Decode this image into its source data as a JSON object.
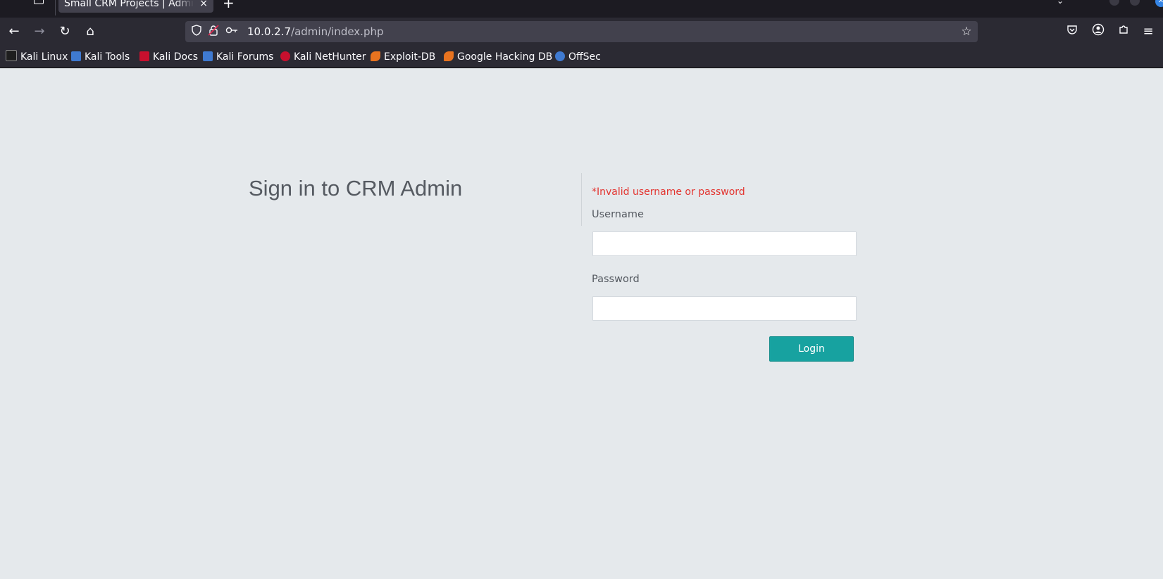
{
  "browser": {
    "tab": {
      "title": "Small CRM Projects | Admin Login",
      "close": "×"
    },
    "new_tab": "+",
    "url": {
      "host": "10.0.2.7",
      "path": "/admin/index.php"
    },
    "bookmarks": [
      {
        "label": "Kali Linux",
        "icon": "kali-dragon-icon",
        "color": "#1e1e1e"
      },
      {
        "label": "Kali Tools",
        "icon": "kali-tools-icon",
        "color": "#3f7ad1"
      },
      {
        "label": "Kali Docs",
        "icon": "kali-docs-icon",
        "color": "#c8102e"
      },
      {
        "label": "Kali Forums",
        "icon": "kali-forums-icon",
        "color": "#3f7ad1"
      },
      {
        "label": "Kali NetHunter",
        "icon": "kali-nethunter-icon",
        "color": "#c8102e"
      },
      {
        "label": "Exploit-DB",
        "icon": "exploit-db-icon",
        "color": "#e8731f"
      },
      {
        "label": "Google Hacking DB",
        "icon": "ghdb-icon",
        "color": "#e8731f"
      },
      {
        "label": "OffSec",
        "icon": "offsec-icon",
        "color": "#3f7ad1"
      }
    ]
  },
  "page": {
    "title": "Sign in to CRM Admin",
    "error": "*Invalid username or password",
    "username_label": "Username",
    "username_value": "",
    "password_label": "Password",
    "password_value": "",
    "login_label": "Login"
  },
  "colors": {
    "background": "#e5e9ec",
    "accent": "#17a2a0",
    "error": "#e3342f"
  }
}
